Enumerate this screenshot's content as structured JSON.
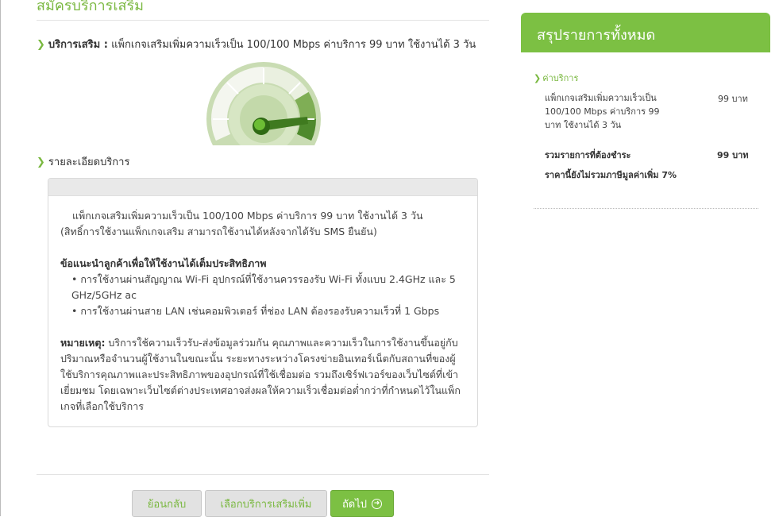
{
  "page": {
    "heading": "สมัครบริการเสริม"
  },
  "addon": {
    "label": "บริการเสริม :",
    "description": "แพ็กเกจเสริมเพิ่มความเร็วเป็น 100/100 Mbps ค่าบริการ 99 บาท ใช้งานได้ 3 วัน"
  },
  "details": {
    "title": "รายละเอียดบริการ",
    "intro": "แพ็กเกจเสริมเพิ่มความเร็วเป็น 100/100 Mbps ค่าบริการ 99 บาท ใช้งานได้ 3 วัน",
    "rights": "(สิทธิ์การใช้งานแพ็กเกจเสริม สามารถใช้งานได้หลังจากได้รับ SMS ยืนยัน)",
    "advice_heading": "ข้อแนะนำลูกค้าเพื่อให้ใช้งานได้เต็มประสิทธิภาพ",
    "bullets": [
      "• การใช้งานผ่านสัญญาณ Wi-Fi อุปกรณ์ที่ใช้งานควรรองรับ Wi-Fi ทั้งแบบ 2.4GHz และ 5 GHz/5GHz ac",
      "• การใช้งานผ่านสาย LAN เช่นคอมพิวเตอร์ ที่ช่อง LAN ต้องรองรับความเร็วที่ 1 Gbps"
    ],
    "note_label": "หมายเหตุ:",
    "note_text": " บริการใช้ความเร็วรับ-ส่งข้อมูลร่วมกัน คุณภาพและความเร็วในการใช้งานขึ้นอยู่กับปริมาณหรือจำนวนผู้ใช้งานในขณะนั้น ระยะทางระหว่างโครงข่ายอินเทอร์เน็ตกับสถานที่ของผู้ใช้บริการคุณภาพและประสิทธิภาพของอุปกรณ์ที่ใช้เชื่อมต่อ รวมถึงเซิร์ฟเวอร์ของเว็บไซต์ที่เข้าเยี่ยมชม โดยเฉพาะเว็บไซต์ต่างประเทศอาจส่งผลให้ความเร็วเชื่อมต่อต่ำกว่าที่กำหนดไว้ในแพ็กเกจที่เลือกใช้บริการ"
  },
  "buttons": {
    "back": "ย้อนกลับ",
    "more_addons": "เลือกบริการเสริมเพิ่ม",
    "next": "ถัดไป"
  },
  "summary": {
    "title": "สรุปรายการทั้งหมด",
    "fee_label": "ค่าบริการ",
    "item_desc": "แพ็กเกจเสริมเพิ่มความเร็วเป็น 100/100 Mbps ค่าบริการ 99 บาท ใช้งานได้ 3 วัน",
    "item_price": "99 บาท",
    "total_label": "รวมรายการที่ต้องชำระ",
    "total_price": "99 บาท",
    "vat_note": "ราคานี้ยังไม่รวมภาษีมูลค่าเพิ่ม 7%"
  },
  "icons": {
    "chevron": "chevron-right-icon",
    "speedometer": "speedometer-icon",
    "next_arrow": "arrow-circle-right-icon"
  },
  "colors": {
    "accent_green": "#7cc043",
    "text_green": "#7ab840",
    "button_gray": "#e2e2e2"
  }
}
